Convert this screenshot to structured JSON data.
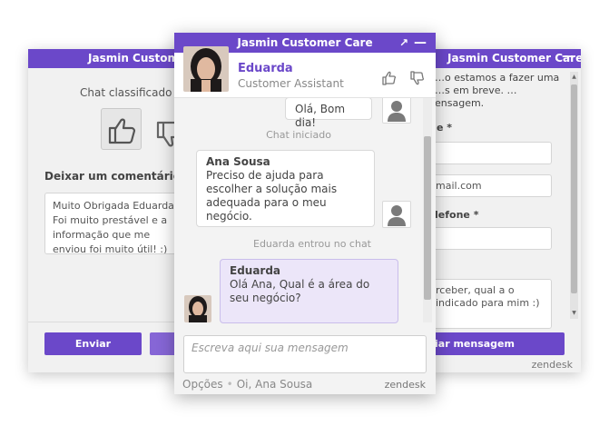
{
  "left_window": {
    "title": "Jasmin Customer Care",
    "rated_text": "Chat classificado co",
    "comment_label": "Deixar um comentário",
    "comment_text": "Muito Obrigada Eduarda! Foi muito prestável e a informação que me enviou foi muito útil! :)",
    "send_label": "Enviar"
  },
  "right_window": {
    "title": "Jasmin Customer Care",
    "description": "…o estamos a fazer uma …s em breve. …ensagem.",
    "name_label": "e *",
    "email_value": "mail.com",
    "phone_label": "lefone *",
    "message_text": "rceber, qual a o indicado para mim :)",
    "send_label": "iar mensagem",
    "brand": "zendesk"
  },
  "chat": {
    "title": "Jasmin Customer Care",
    "agent_name": "Eduarda",
    "agent_role": "Customer Assistant",
    "messages": {
      "m1": {
        "text": "Olá, Bom dia!"
      },
      "sys1": "Chat iniciado",
      "m2": {
        "author": "Ana Sousa",
        "text": "Preciso de ajuda para escolher a solução mais adequada para o meu negócio."
      },
      "sys2": "Eduarda entrou no chat",
      "m3": {
        "author": "Eduarda",
        "text": "Olá Ana, Qual é a área do seu negócio?"
      }
    },
    "input_placeholder": "Escreva aqui sua mensagem",
    "footer_options": "Opções",
    "footer_greeting": "Oi, Ana Sousa",
    "brand": "zendesk"
  },
  "colors": {
    "accent": "#6b48c9",
    "bubble_agent": "#ece6f9"
  },
  "icons": [
    "thumbs-up-icon",
    "thumbs-down-icon",
    "expand-icon",
    "minimize-icon",
    "user-avatar-icon"
  ]
}
